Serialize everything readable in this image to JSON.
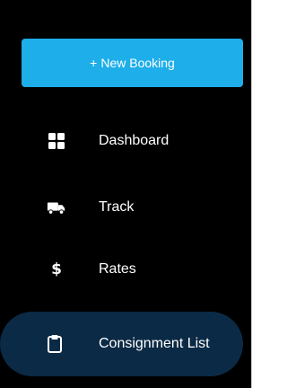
{
  "sidebar": {
    "new_booking": {
      "plus": "+",
      "label": "New Booking"
    },
    "items": [
      {
        "label": "Dashboard",
        "icon": "dashboard-grid-icon"
      },
      {
        "label": "Track",
        "icon": "truck-icon"
      },
      {
        "label": "Rates",
        "icon": "dollar-icon",
        "glyph": "$"
      },
      {
        "label": "Consignment List",
        "icon": "clipboard-icon",
        "active": true
      }
    ]
  },
  "colors": {
    "sidebar_bg": "#000000",
    "accent": "#1eaee9",
    "active_item_bg": "#0b2a45",
    "text": "#ffffff"
  }
}
